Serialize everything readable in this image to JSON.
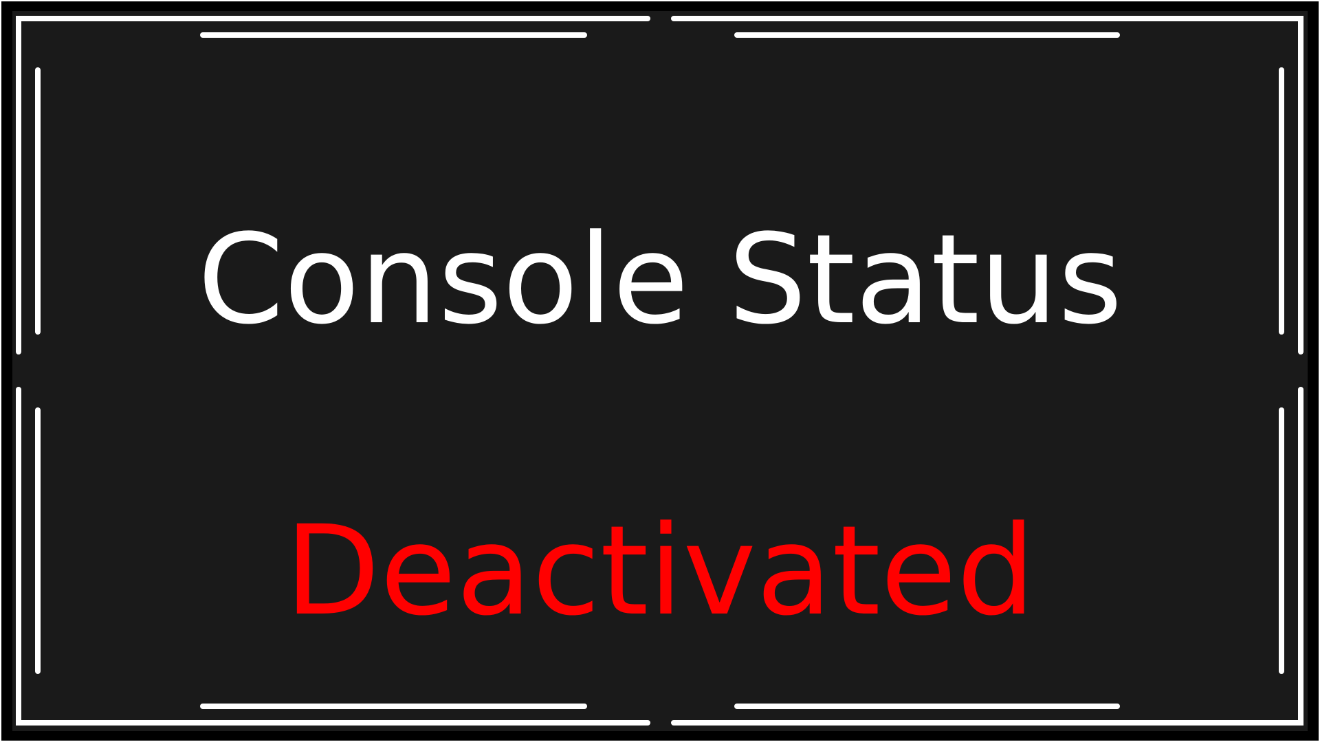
{
  "console": {
    "title": "Console Status",
    "status": "Deactivated"
  },
  "colors": {
    "background": "#1a1a1a",
    "frame": "#ffffff",
    "title_text": "#ffffff",
    "status_text": "#ff0000"
  }
}
